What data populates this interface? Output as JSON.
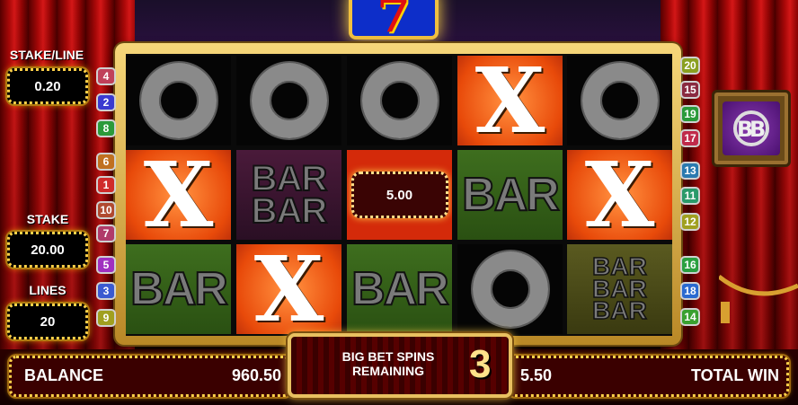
{
  "game": {
    "title_icon": "seven-icon",
    "title_glyph": "7",
    "logo_icon": "bb-logo-icon"
  },
  "side_left": {
    "stake_line_label": "STAKE/LINE",
    "stake_line_value": "0.20",
    "stake_label": "STAKE",
    "stake_value": "20.00",
    "lines_label": "LINES",
    "lines_value": "20"
  },
  "line_numbers_left": [
    {
      "n": "4",
      "color": "#c0405a"
    },
    {
      "n": "2",
      "color": "#3a3ad0"
    },
    {
      "n": "8",
      "color": "#2a9a3a"
    },
    {
      "n": "6",
      "color": "#c07020"
    },
    {
      "n": "1",
      "color": "#d02a2a"
    },
    {
      "n": "10",
      "color": "#b04a30"
    },
    {
      "n": "7",
      "color": "#b03a6a"
    },
    {
      "n": "5",
      "color": "#a030c0"
    },
    {
      "n": "3",
      "color": "#3a5ad0"
    },
    {
      "n": "9",
      "color": "#a0a020"
    }
  ],
  "line_numbers_right": [
    {
      "n": "20",
      "color": "#8aa020"
    },
    {
      "n": "15",
      "color": "#8a2a40"
    },
    {
      "n": "19",
      "color": "#2a9a3a"
    },
    {
      "n": "17",
      "color": "#c02a4a"
    },
    {
      "n": "13",
      "color": "#2a7ab0"
    },
    {
      "n": "11",
      "color": "#2a9a6a"
    },
    {
      "n": "12",
      "color": "#a0a020"
    },
    {
      "n": "16",
      "color": "#2aa040"
    },
    {
      "n": "18",
      "color": "#2a6ad0"
    },
    {
      "n": "14",
      "color": "#3aa030"
    }
  ],
  "reels": [
    [
      {
        "symbol": "O"
      },
      {
        "symbol": "X"
      },
      {
        "symbol": "BAR"
      }
    ],
    [
      {
        "symbol": "O"
      },
      {
        "symbol": "BARBAR"
      },
      {
        "symbol": "X"
      }
    ],
    [
      {
        "symbol": "O"
      },
      {
        "symbol": "WIN",
        "value": "5.00"
      },
      {
        "symbol": "BAR"
      }
    ],
    [
      {
        "symbol": "X"
      },
      {
        "symbol": "BAR"
      },
      {
        "symbol": "O"
      }
    ],
    [
      {
        "symbol": "O"
      },
      {
        "symbol": "X"
      },
      {
        "symbol": "BARBARBAR"
      }
    ]
  ],
  "symbol_text": {
    "x": "X",
    "bar": "BAR"
  },
  "bottom": {
    "balance_label": "BALANCE",
    "balance_value": "960.50",
    "bigbet_label": "BIG BET SPINS REMAINING",
    "bigbet_count": "3",
    "win_value": "5.50",
    "total_win_label": "TOTAL WIN"
  },
  "colors": {
    "gold": "#ffd24a",
    "curtain": "#c00a0a",
    "x_orange": "#e84a0a",
    "bar_green": "#3e6e1e"
  }
}
